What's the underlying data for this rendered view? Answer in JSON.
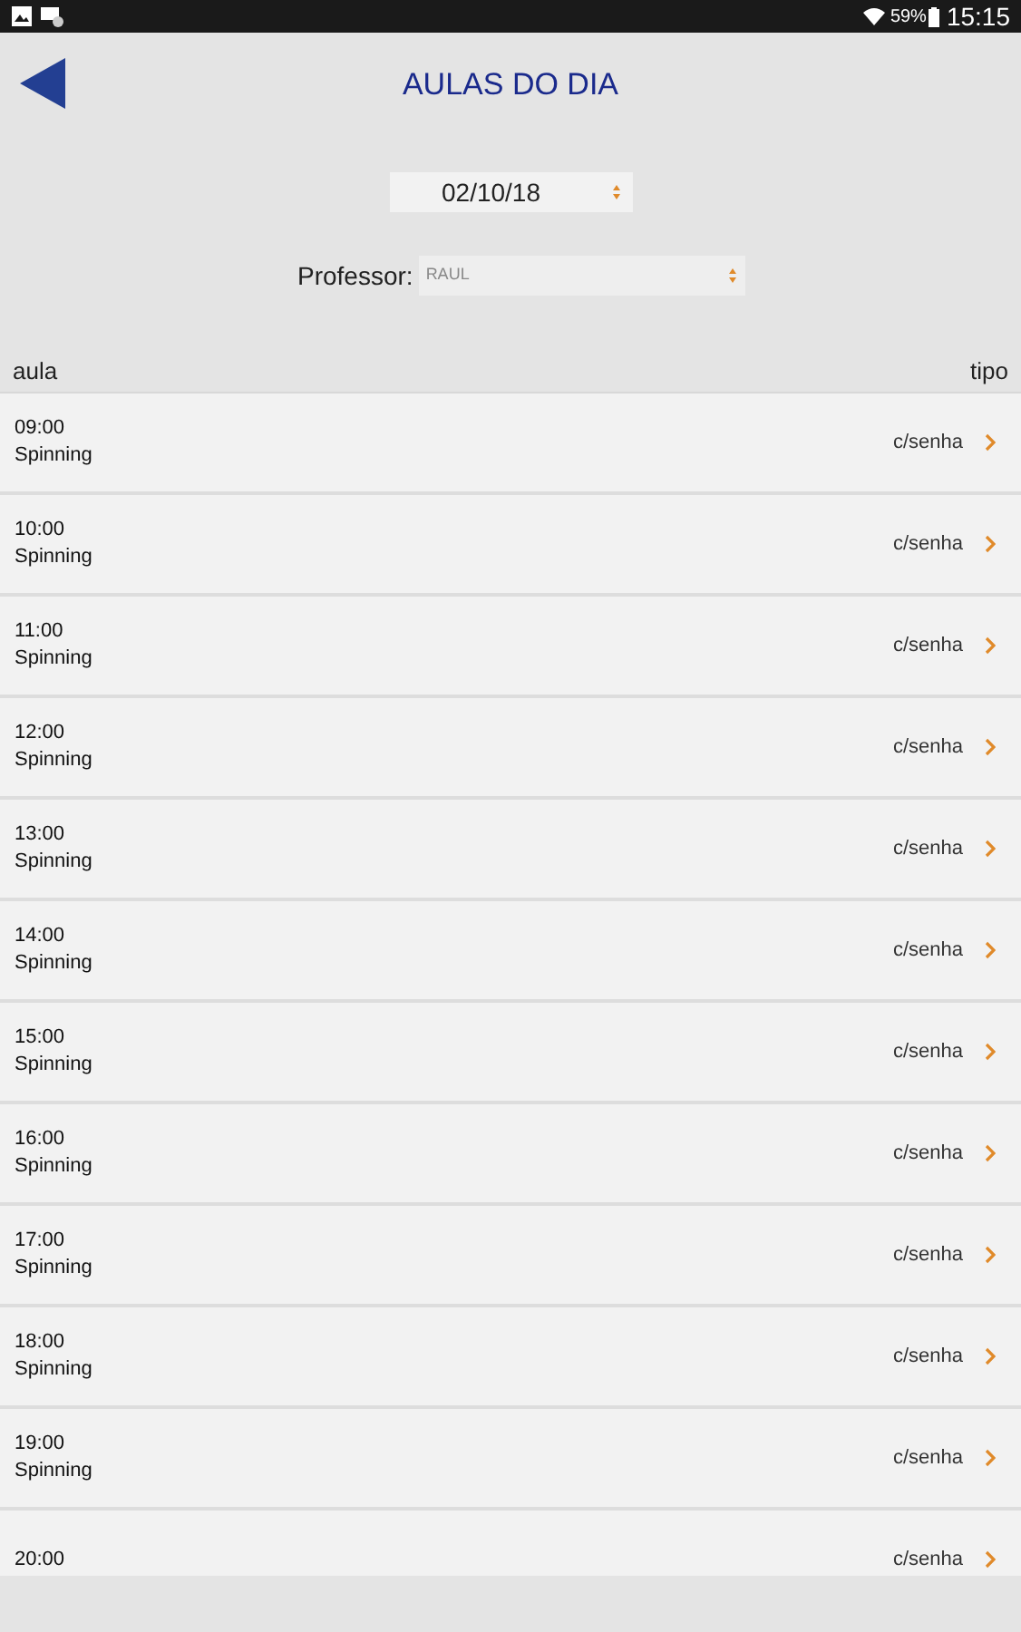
{
  "status_bar": {
    "battery": "59%",
    "time": "15:15"
  },
  "header": {
    "title": "AULAS DO DIA"
  },
  "date_select": {
    "value": "02/10/18"
  },
  "professor": {
    "label": "Professor:",
    "value": "RAUL"
  },
  "table": {
    "columns": [
      "aula",
      "tipo"
    ],
    "rows": [
      {
        "time": "09:00",
        "name": "Spinning",
        "type": "c/senha"
      },
      {
        "time": "10:00",
        "name": "Spinning",
        "type": "c/senha"
      },
      {
        "time": "11:00",
        "name": "Spinning",
        "type": "c/senha"
      },
      {
        "time": "12:00",
        "name": "Spinning",
        "type": "c/senha"
      },
      {
        "time": "13:00",
        "name": "Spinning",
        "type": "c/senha"
      },
      {
        "time": "14:00",
        "name": "Spinning",
        "type": "c/senha"
      },
      {
        "time": "15:00",
        "name": "Spinning",
        "type": "c/senha"
      },
      {
        "time": "16:00",
        "name": "Spinning",
        "type": "c/senha"
      },
      {
        "time": "17:00",
        "name": "Spinning",
        "type": "c/senha"
      },
      {
        "time": "18:00",
        "name": "Spinning",
        "type": "c/senha"
      },
      {
        "time": "19:00",
        "name": "Spinning",
        "type": "c/senha"
      },
      {
        "time": "20:00",
        "type": "c/senha"
      }
    ]
  }
}
